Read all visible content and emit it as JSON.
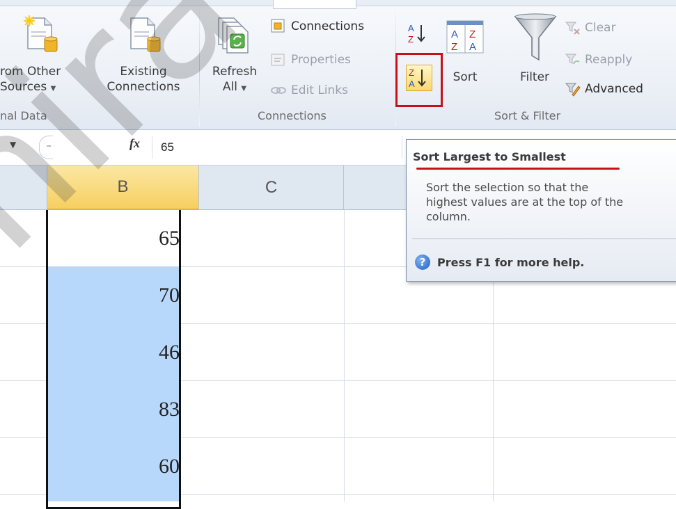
{
  "ribbon": {
    "get_external": {
      "from_other_sources_line1": "rom Other",
      "from_other_sources_line2": "Sources",
      "existing_connections_line1": "Existing",
      "existing_connections_line2": "Connections",
      "group_label": "nal Data"
    },
    "connections": {
      "refresh_all_line1": "Refresh",
      "refresh_all_line2": "All",
      "connections_label": "Connections",
      "properties_label": "Properties",
      "edit_links_label": "Edit Links",
      "group_label": "Connections"
    },
    "sort_filter": {
      "sort_label": "Sort",
      "filter_label": "Filter",
      "clear_label": "Clear",
      "reapply_label": "Reapply",
      "advanced_label": "Advanced",
      "group_label": "Sort & Filter",
      "highlight_color": "#c8101a"
    }
  },
  "formula_bar": {
    "fx_label": "fx",
    "value": "65"
  },
  "sheet": {
    "columns": [
      "B",
      "C"
    ],
    "column_b_values": [
      "65",
      "70",
      "46",
      "83",
      "60"
    ],
    "selection_color": "#b7d7fb",
    "header_selected_color": "#f9d86e"
  },
  "tooltip": {
    "title": "Sort Largest to Smallest",
    "description_line1": "Sort the selection so that the",
    "description_line2": "highest values are at the top of the",
    "description_line3": "column.",
    "help_text": "Press F1 for more help.",
    "underline_color": "#c8101a"
  },
  "watermark": {
    "text": "hiraclu"
  }
}
